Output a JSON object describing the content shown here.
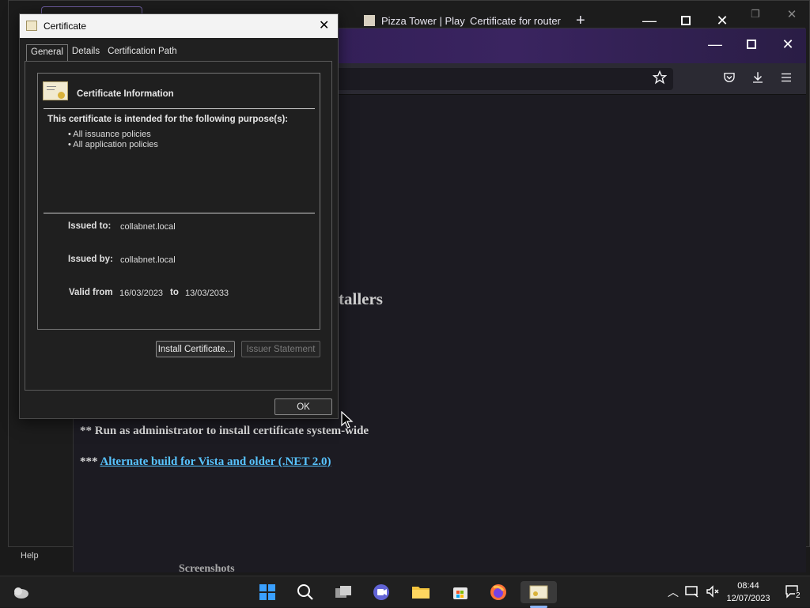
{
  "browser": {
    "tabs": [
      {
        "label": "Pizza Tower | Play"
      },
      {
        "label": "Certificate for router"
      }
    ],
    "new_tab_symbol": "+"
  },
  "page": {
    "heading_fragment": "tallers",
    "note1": "** Run as administrator to install certificate system-wide",
    "note2_prefix": "***",
    "note2_link": "Alternate build for Vista and older (.NET 2.0)"
  },
  "background": {
    "help_label": "Help",
    "screenshots_label": "Screenshots"
  },
  "dialog": {
    "title": "Certificate",
    "tabs": [
      "General",
      "Details",
      "Certification Path"
    ],
    "info_title": "Certificate Information",
    "purpose_heading": "This certificate is intended for the following purpose(s):",
    "purposes": [
      "• All issuance policies",
      "• All application policies"
    ],
    "issued_to_label": "Issued to:",
    "issued_to_value": "collabnet.local",
    "issued_by_label": "Issued by:",
    "issued_by_value": "collabnet.local",
    "valid_from_label": "Valid from",
    "valid_from_value": "16/03/2023",
    "to_label": "to",
    "valid_to_value": "13/03/2033",
    "install_button": "Install Certificate...",
    "issuer_statement_button": "Issuer Statement",
    "ok_button": "OK"
  },
  "taskbar": {
    "time": "08:44",
    "date": "12/07/2023",
    "notification_count": "2"
  },
  "colors": {
    "accent_link": "#58c4ff",
    "firefox_tab_gradient": "#3a2460"
  }
}
